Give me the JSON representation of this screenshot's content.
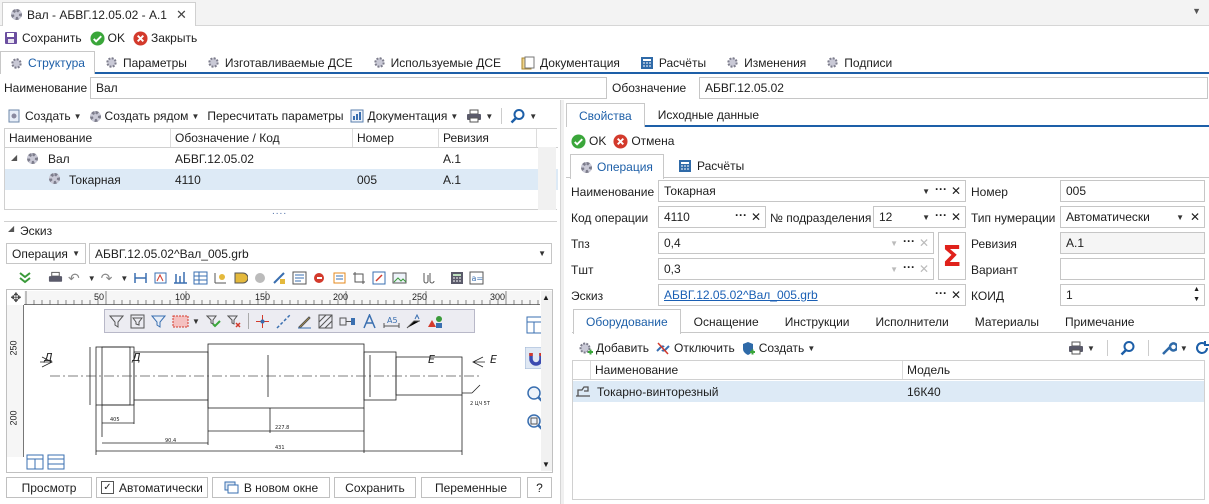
{
  "window": {
    "title": "Вал - АБВГ.12.05.02 - А.1"
  },
  "toolbar": {
    "save": "Сохранить",
    "ok": "OK",
    "close": "Закрыть"
  },
  "main_tabs": [
    {
      "label": "Структура",
      "active": true
    },
    {
      "label": "Параметры"
    },
    {
      "label": "Изготавливаемые ДСЕ"
    },
    {
      "label": "Используемые ДСЕ"
    },
    {
      "label": "Документация"
    },
    {
      "label": "Расчёты"
    },
    {
      "label": "Изменения"
    },
    {
      "label": "Подписи"
    }
  ],
  "header_fields": {
    "name_label": "Наименование",
    "name_value": "Вал",
    "designation_label": "Обозначение",
    "designation_value": "АБВГ.12.05.02"
  },
  "structure_toolbar": {
    "create": "Создать",
    "create_near": "Создать рядом",
    "recalc": "Пересчитать параметры",
    "docs": "Документация"
  },
  "tree": {
    "columns": [
      "Наименование",
      "Обозначение / Код",
      "Номер",
      "Ревизия"
    ],
    "rows": [
      {
        "name": "Вал",
        "code": "АБВГ.12.05.02",
        "number": "",
        "revision": "А.1"
      },
      {
        "name": "Токарная",
        "code": "4110",
        "number": "005",
        "revision": "А.1"
      }
    ],
    "more": "...."
  },
  "sketch": {
    "title": "Эскиз",
    "type_select": "Операция",
    "file_select": "АБВГ.12.05.02^Вал_005.grb",
    "ruler_h": [
      "50",
      "100",
      "150",
      "200",
      "250",
      "300"
    ],
    "ruler_v": [
      "250",
      "200"
    ],
    "drawing": {
      "label_d1": "Д",
      "label_d2": "Д",
      "label_e1": "Е",
      "label_e2": "Е",
      "dim1": "405",
      "dim2": "90.4",
      "dim3": "227.8",
      "dim4": "431",
      "note": "2 ЦЧ 5Т"
    },
    "buttons": {
      "preview": "Просмотр",
      "auto": "Автоматически",
      "new_window": "В новом окне",
      "save": "Сохранить",
      "variables": "Переменные",
      "help": "?"
    },
    "auto_checked": true
  },
  "right_tabs": [
    {
      "label": "Свойства",
      "active": true
    },
    {
      "label": "Исходные данные"
    }
  ],
  "right_actions": {
    "ok": "OK",
    "cancel": "Отмена"
  },
  "sub_tabs": [
    {
      "label": "Операция",
      "active": true
    },
    {
      "label": "Расчёты"
    }
  ],
  "operation": {
    "name_label": "Наименование",
    "name_value": "Токарная",
    "code_label": "Код операции",
    "code_value": "4110",
    "dept_label": "№ подразделения",
    "dept_value": "12",
    "tpz_label": "Тпз",
    "tpz_value": "0,4",
    "tsht_label": "Тшт",
    "tsht_value": "0,3",
    "sketch_label": "Эскиз",
    "sketch_value": "АБВГ.12.05.02^Вал_005.grb",
    "number_label": "Номер",
    "number_value": "005",
    "numtype_label": "Тип нумерации",
    "numtype_value": "Автоматически",
    "revision_label": "Ревизия",
    "revision_value": "А.1",
    "variant_label": "Вариант",
    "variant_value": "",
    "koid_label": "КОИД",
    "koid_value": "1",
    "sigma": "Σ"
  },
  "bottom_tabs": [
    {
      "label": "Оборудование",
      "active": true
    },
    {
      "label": "Оснащение"
    },
    {
      "label": "Инструкции"
    },
    {
      "label": "Исполнители"
    },
    {
      "label": "Материалы"
    },
    {
      "label": "Примечание"
    }
  ],
  "equip_toolbar": {
    "add": "Добавить",
    "detach": "Отключить",
    "create": "Создать"
  },
  "equipment": {
    "columns": [
      "Наименование",
      "Модель"
    ],
    "rows": [
      {
        "name": "Токарно-винторезный",
        "model": "16К40"
      }
    ]
  },
  "colors": {
    "accent": "#1d5fa8",
    "ok_green": "#3aa63a",
    "cancel_red": "#d33a2c",
    "selected_row": "#ddeaf6",
    "sigma_red": "#e0211b",
    "link": "#1a5fb4"
  }
}
